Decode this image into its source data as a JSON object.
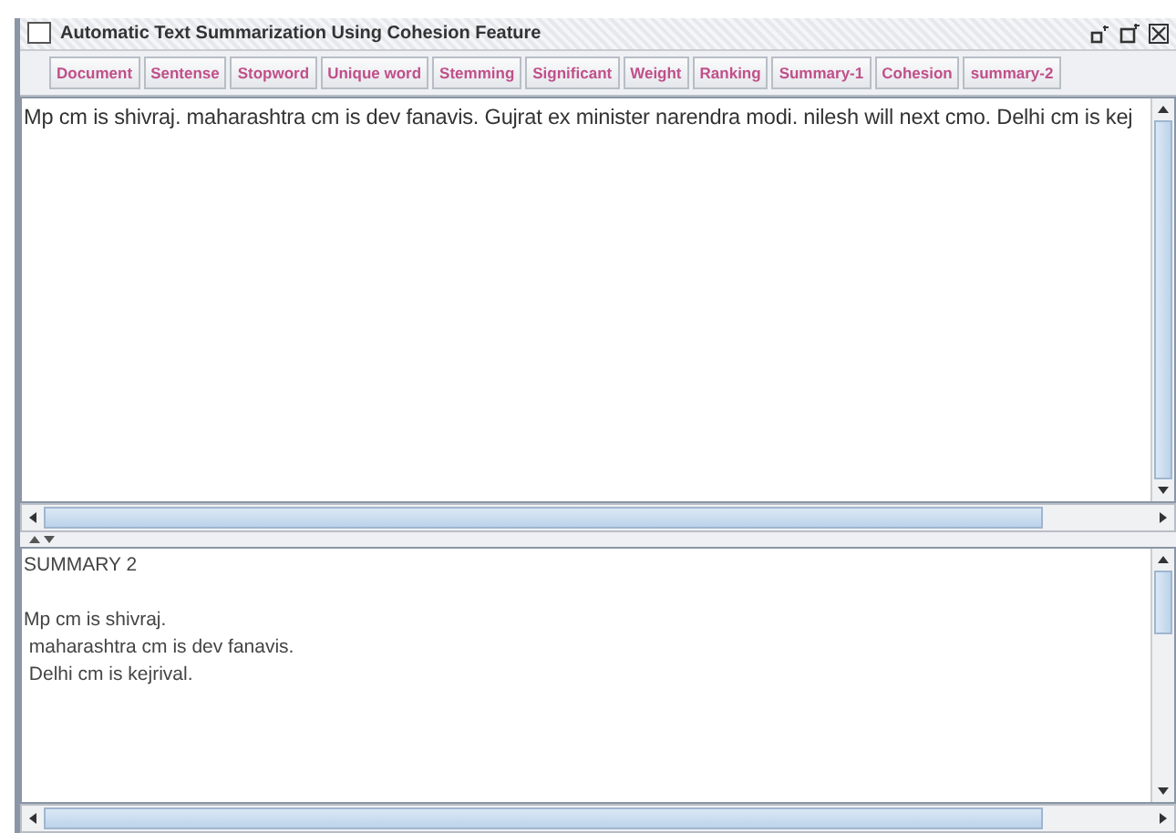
{
  "window": {
    "title": "Automatic Text Summarization Using Cohesion Feature"
  },
  "toolbar": [
    "Document",
    "Sentense",
    "Stopword",
    "Unique word",
    "Stemming",
    "Significant",
    "Weight",
    "Ranking",
    "Summary-1",
    "Cohesion",
    "summary-2"
  ],
  "document_text": "Mp cm is shivraj. maharashtra cm is dev fanavis. Gujrat ex minister narendra modi. nilesh will next cmo. Delhi cm is kej",
  "summary_lines": [
    "SUMMARY 2",
    "Mp cm is shivraj.",
    " maharashtra cm is dev fanavis.",
    " Delhi cm is kejrival."
  ]
}
